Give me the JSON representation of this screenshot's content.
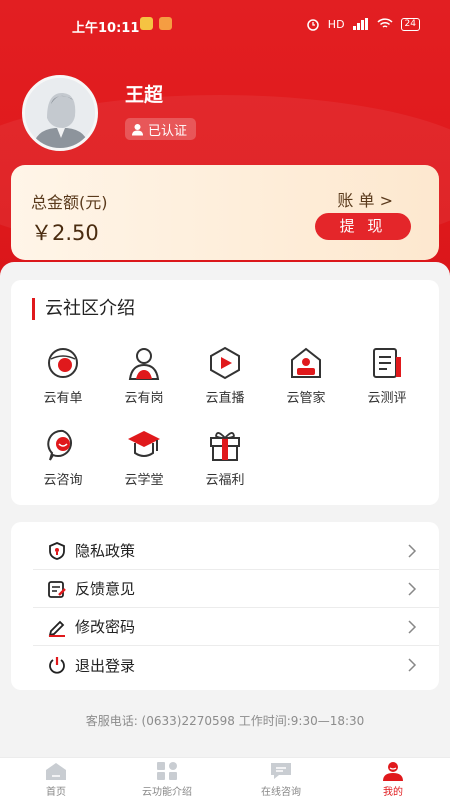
{
  "status_bar": {
    "time": "上午10:11",
    "network": "HD",
    "battery": "24"
  },
  "profile": {
    "name": "王超",
    "verified_label": "已认证"
  },
  "balance": {
    "title": "总金额(元)",
    "amount": "￥2.50",
    "bill_link": "账 单 >",
    "withdraw_label": "提 现"
  },
  "intro": {
    "title": "云社区介绍",
    "features": [
      {
        "label": "云有单",
        "icon": "order-globe-icon"
      },
      {
        "label": "云有岗",
        "icon": "job-person-icon"
      },
      {
        "label": "云直播",
        "icon": "live-play-icon"
      },
      {
        "label": "云管家",
        "icon": "house-keeper-icon"
      },
      {
        "label": "云测评",
        "icon": "assessment-doc-icon"
      },
      {
        "label": "云咨询",
        "icon": "consult-chat-icon"
      },
      {
        "label": "云学堂",
        "icon": "graduation-cap-icon"
      },
      {
        "label": "云福利",
        "icon": "gift-box-icon"
      }
    ]
  },
  "menu": [
    {
      "label": "隐私政策",
      "icon": "privacy-shield-icon"
    },
    {
      "label": "反馈意见",
      "icon": "feedback-edit-icon"
    },
    {
      "label": "修改密码",
      "icon": "pen-icon"
    },
    {
      "label": "退出登录",
      "icon": "power-icon"
    }
  ],
  "service_line": "客服电话: (0633)2270598 工作时间:9:30—18:30",
  "tabs": [
    {
      "label": "首页",
      "icon": "home-icon",
      "active": false
    },
    {
      "label": "云功能介绍",
      "icon": "grid-icon",
      "active": false
    },
    {
      "label": "在线咨询",
      "icon": "chat-icon",
      "active": false
    },
    {
      "label": "我的",
      "icon": "user-icon",
      "active": true
    }
  ],
  "colors": {
    "primary": "#e0191c",
    "card_gold": "#fde8cf",
    "text_brown": "#5a3a1c"
  }
}
